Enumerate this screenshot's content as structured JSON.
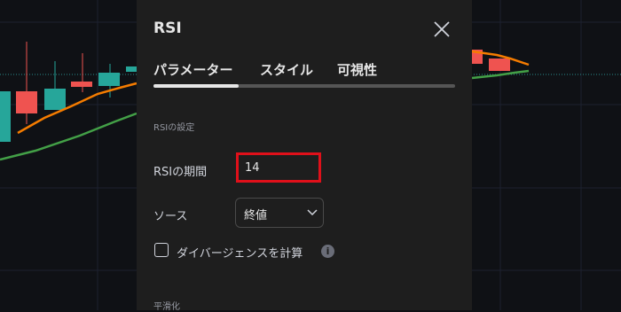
{
  "dialog": {
    "title": "RSI",
    "tabs": [
      {
        "label": "パラメーター",
        "active": true
      },
      {
        "label": "スタイル",
        "active": false
      },
      {
        "label": "可視性",
        "active": false
      }
    ],
    "section_rsi_settings": "RSIの設定",
    "rsi_period": {
      "label": "RSIの期間",
      "value": "14"
    },
    "source": {
      "label": "ソース",
      "selected": "終値"
    },
    "divergence": {
      "label": "ダイバージェンスを計算",
      "checked": false
    },
    "section_smoothing": "平滑化"
  },
  "icons": {
    "close": "close-icon",
    "chevron": "chevron-down-icon",
    "info": "info-icon"
  },
  "colors": {
    "dialog_bg": "#1e1e1e",
    "chart_bg": "#0f1115",
    "highlight_border": "#e0101a",
    "candle_up": "#26a69a",
    "candle_down": "#ef5350",
    "ma_orange": "#f57c00",
    "ma_green": "#43a047"
  }
}
